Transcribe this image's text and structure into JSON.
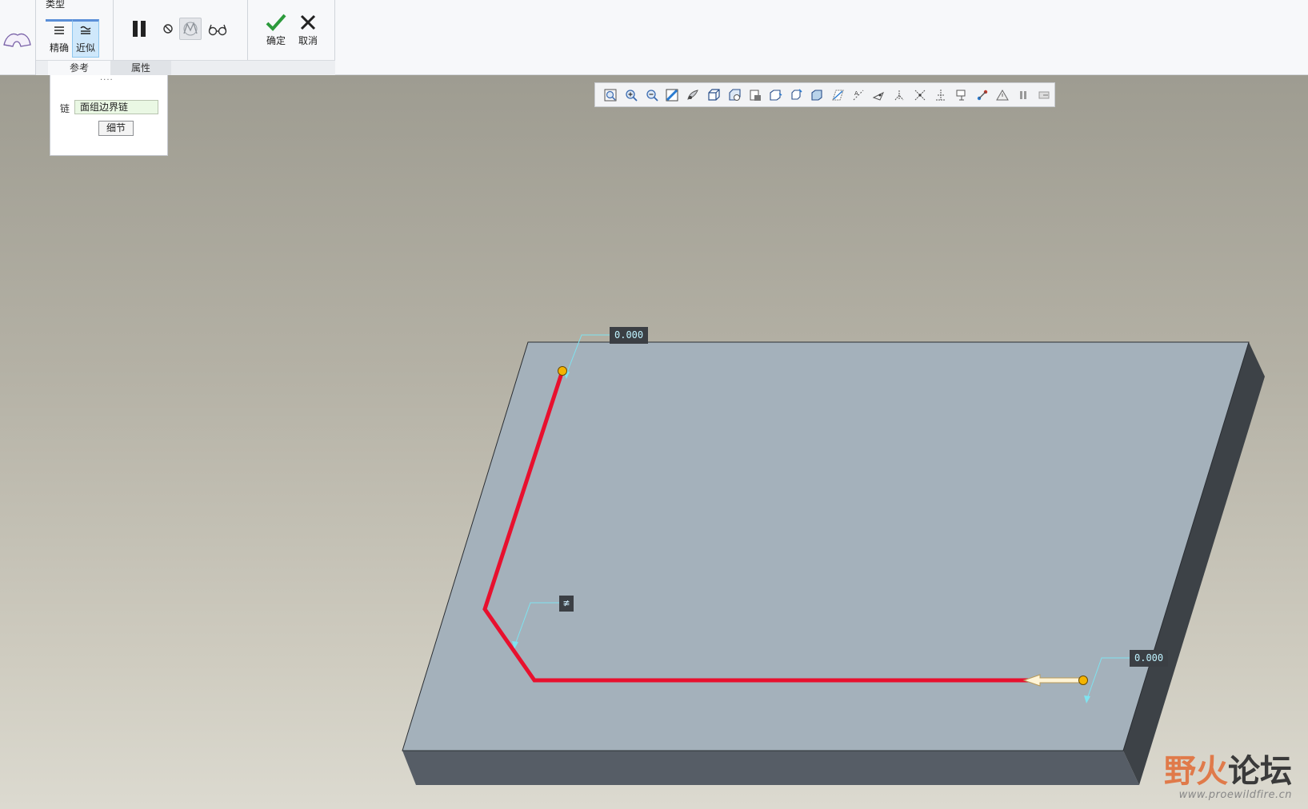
{
  "ribbon": {
    "type_group_label": "类型",
    "precise_label": "精确",
    "approx_label": "近似",
    "ok_label": "确定",
    "cancel_label": "取消",
    "tabs": [
      {
        "label": "参考"
      },
      {
        "label": "属性"
      }
    ]
  },
  "ref_panel": {
    "dots": "....",
    "chain_label": "链",
    "chain_value": "面组边界链",
    "detail_button": "细节"
  },
  "view_toolbar": {
    "icons": [
      "refit-icon",
      "zoom-in-icon",
      "zoom-out-icon",
      "repaint-icon",
      "shading-icon",
      "orientation-icon",
      "saved-views-icon",
      "view-manager-icon",
      "perspective-icon",
      "spin-center-icon",
      "display-style-icon",
      "plane-display-icon",
      "axis-display-icon",
      "point-display-icon",
      "csys-display-icon",
      "annotation-display-icon",
      "point-tag-icon",
      "csys-tag-icon",
      "section-icon",
      "network-icon",
      "mass-icon",
      "pause-icon",
      "exit-icon"
    ]
  },
  "viewport": {
    "dim_top": "0.000",
    "dim_right": "0.000",
    "glyph_mid": "≢"
  },
  "watermark": {
    "title_a": "野火",
    "title_b": "论坛",
    "url": "www.proewildfire.cn"
  },
  "colors": {
    "trajectory": "#e8102e",
    "slab_top": "#a4b1bb",
    "slab_side": "#3d4247",
    "slab_front": "#565d66",
    "handle": "#f4b400",
    "accent": "#5b8fd8"
  }
}
